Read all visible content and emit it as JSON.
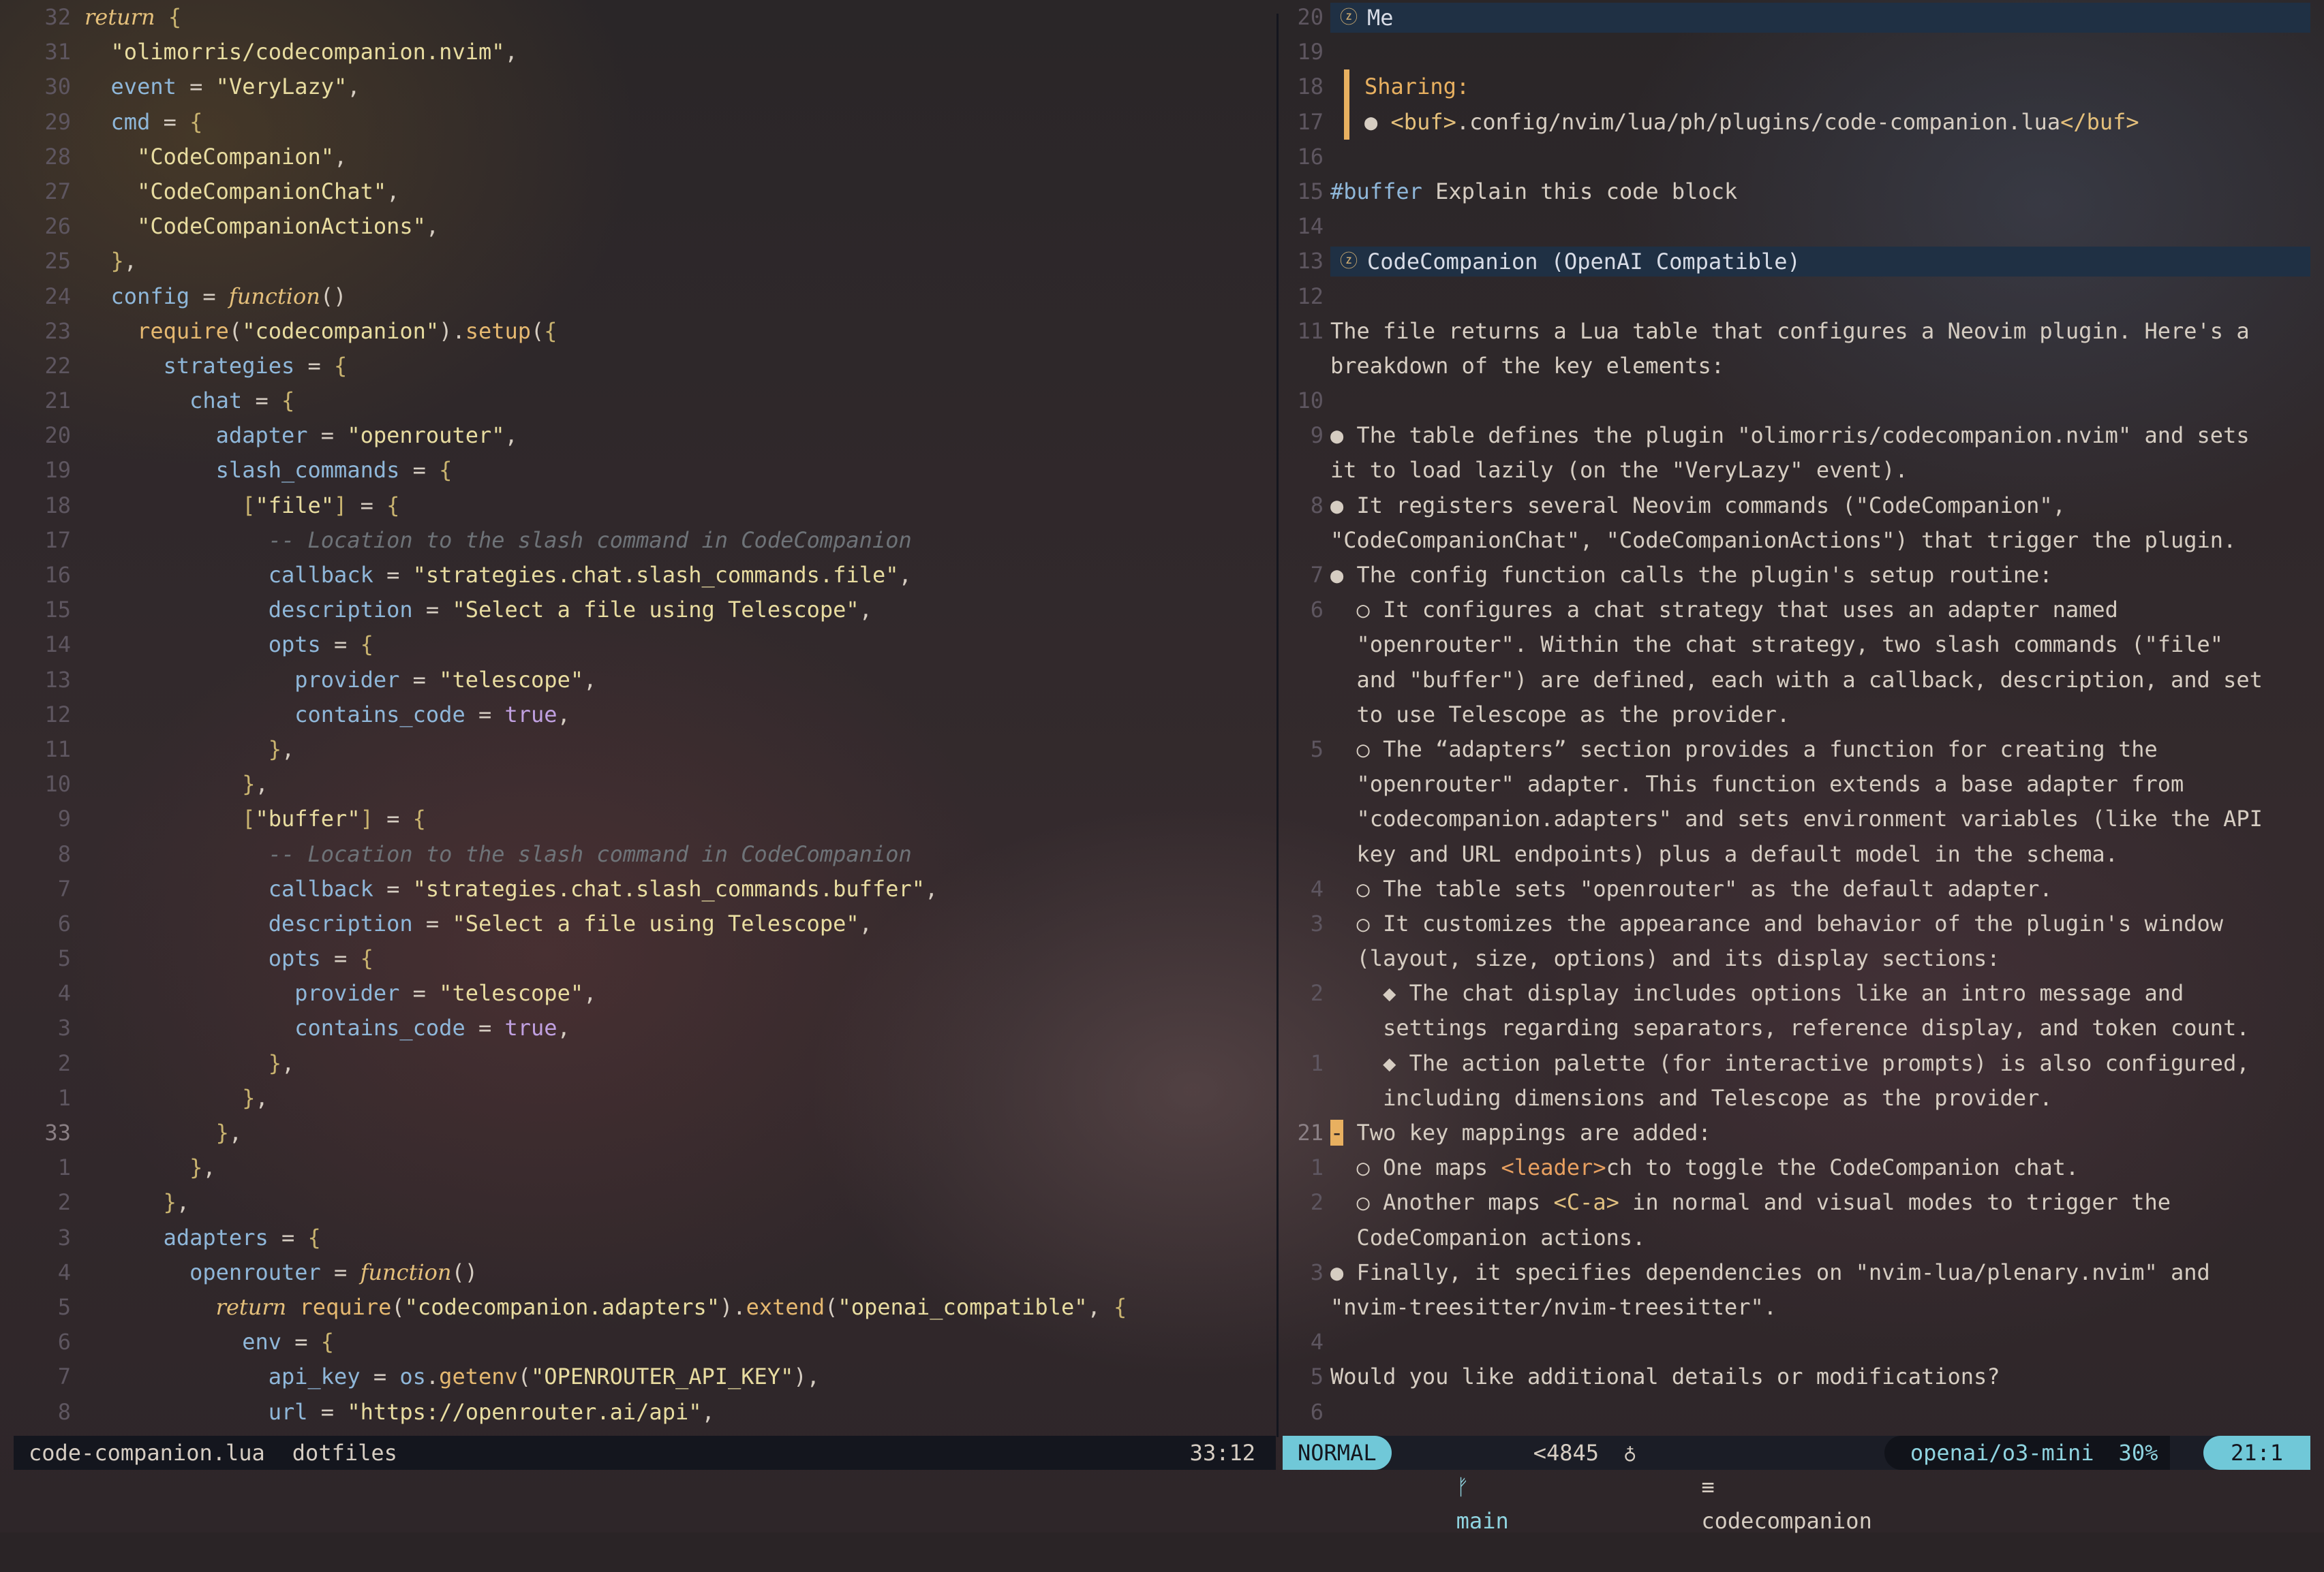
{
  "left_editor": {
    "lines": [
      {
        "n": "32",
        "t": [
          [
            "kw",
            "return"
          ],
          [
            "op",
            " "
          ],
          [
            "pun",
            "{"
          ]
        ]
      },
      {
        "n": "31",
        "t": [
          [
            "op",
            "  "
          ],
          [
            "str",
            "\"olimorris/codecompanion.nvim\""
          ],
          [
            "op",
            ","
          ]
        ]
      },
      {
        "n": "30",
        "t": [
          [
            "op",
            "  "
          ],
          [
            "fld",
            "event"
          ],
          [
            "op",
            " = "
          ],
          [
            "str",
            "\"VeryLazy\""
          ],
          [
            "op",
            ","
          ]
        ]
      },
      {
        "n": "29",
        "t": [
          [
            "op",
            "  "
          ],
          [
            "fld",
            "cmd"
          ],
          [
            "op",
            " = "
          ],
          [
            "pun",
            "{"
          ]
        ]
      },
      {
        "n": "28",
        "t": [
          [
            "op",
            "    "
          ],
          [
            "str",
            "\"CodeCompanion\""
          ],
          [
            "op",
            ","
          ]
        ]
      },
      {
        "n": "27",
        "t": [
          [
            "op",
            "    "
          ],
          [
            "str",
            "\"CodeCompanionChat\""
          ],
          [
            "op",
            ","
          ]
        ]
      },
      {
        "n": "26",
        "t": [
          [
            "op",
            "    "
          ],
          [
            "str",
            "\"CodeCompanionActions\""
          ],
          [
            "op",
            ","
          ]
        ]
      },
      {
        "n": "25",
        "t": [
          [
            "op",
            "  "
          ],
          [
            "pun",
            "}"
          ],
          [
            "op",
            ","
          ]
        ]
      },
      {
        "n": "24",
        "t": [
          [
            "op",
            "  "
          ],
          [
            "fld",
            "config"
          ],
          [
            "op",
            " = "
          ],
          [
            "kw",
            "function"
          ],
          [
            "op",
            "()"
          ]
        ]
      },
      {
        "n": "23",
        "t": [
          [
            "op",
            "    "
          ],
          [
            "fn",
            "require"
          ],
          [
            "op",
            "("
          ],
          [
            "str",
            "\"codecompanion\""
          ],
          [
            "op",
            ")."
          ],
          [
            "fn",
            "setup"
          ],
          [
            "op",
            "("
          ],
          [
            "pun",
            "{"
          ]
        ]
      },
      {
        "n": "22",
        "t": [
          [
            "op",
            "      "
          ],
          [
            "fld",
            "strategies"
          ],
          [
            "op",
            " = "
          ],
          [
            "pun",
            "{"
          ]
        ]
      },
      {
        "n": "21",
        "t": [
          [
            "op",
            "        "
          ],
          [
            "fld",
            "chat"
          ],
          [
            "op",
            " = "
          ],
          [
            "pun",
            "{"
          ]
        ]
      },
      {
        "n": "20",
        "t": [
          [
            "op",
            "          "
          ],
          [
            "fld",
            "adapter"
          ],
          [
            "op",
            " = "
          ],
          [
            "str",
            "\"openrouter\""
          ],
          [
            "op",
            ","
          ]
        ]
      },
      {
        "n": "19",
        "t": [
          [
            "op",
            "          "
          ],
          [
            "fld",
            "slash_commands"
          ],
          [
            "op",
            " = "
          ],
          [
            "pun",
            "{"
          ]
        ]
      },
      {
        "n": "18",
        "t": [
          [
            "op",
            "            "
          ],
          [
            "pun",
            "["
          ],
          [
            "str",
            "\"file\""
          ],
          [
            "pun",
            "]"
          ],
          [
            "op",
            " = "
          ],
          [
            "pun",
            "{"
          ]
        ]
      },
      {
        "n": "17",
        "t": [
          [
            "op",
            "              "
          ],
          [
            "cmt",
            "-- Location to the slash command in CodeCompanion"
          ]
        ]
      },
      {
        "n": "16",
        "t": [
          [
            "op",
            "              "
          ],
          [
            "fld",
            "callback"
          ],
          [
            "op",
            " = "
          ],
          [
            "str",
            "\"strategies.chat.slash_commands.file\""
          ],
          [
            "op",
            ","
          ]
        ]
      },
      {
        "n": "15",
        "t": [
          [
            "op",
            "              "
          ],
          [
            "fld",
            "description"
          ],
          [
            "op",
            " = "
          ],
          [
            "str",
            "\"Select a file using Telescope\""
          ],
          [
            "op",
            ","
          ]
        ]
      },
      {
        "n": "14",
        "t": [
          [
            "op",
            "              "
          ],
          [
            "fld",
            "opts"
          ],
          [
            "op",
            " = "
          ],
          [
            "pun",
            "{"
          ]
        ]
      },
      {
        "n": "13",
        "t": [
          [
            "op",
            "                "
          ],
          [
            "fld",
            "provider"
          ],
          [
            "op",
            " = "
          ],
          [
            "str",
            "\"telescope\""
          ],
          [
            "op",
            ","
          ]
        ]
      },
      {
        "n": "12",
        "t": [
          [
            "op",
            "                "
          ],
          [
            "fld",
            "contains_code"
          ],
          [
            "op",
            " = "
          ],
          [
            "bool",
            "true"
          ],
          [
            "op",
            ","
          ]
        ]
      },
      {
        "n": "11",
        "t": [
          [
            "op",
            "              "
          ],
          [
            "pun",
            "}"
          ],
          [
            "op",
            ","
          ]
        ]
      },
      {
        "n": "10",
        "t": [
          [
            "op",
            "            "
          ],
          [
            "pun",
            "}"
          ],
          [
            "op",
            ","
          ]
        ]
      },
      {
        "n": "9",
        "t": [
          [
            "op",
            "            "
          ],
          [
            "pun",
            "["
          ],
          [
            "str",
            "\"buffer\""
          ],
          [
            "pun",
            "]"
          ],
          [
            "op",
            " = "
          ],
          [
            "pun",
            "{"
          ]
        ]
      },
      {
        "n": "8",
        "t": [
          [
            "op",
            "              "
          ],
          [
            "cmt",
            "-- Location to the slash command in CodeCompanion"
          ]
        ]
      },
      {
        "n": "7",
        "t": [
          [
            "op",
            "              "
          ],
          [
            "fld",
            "callback"
          ],
          [
            "op",
            " = "
          ],
          [
            "str",
            "\"strategies.chat.slash_commands.buffer\""
          ],
          [
            "op",
            ","
          ]
        ]
      },
      {
        "n": "6",
        "t": [
          [
            "op",
            "              "
          ],
          [
            "fld",
            "description"
          ],
          [
            "op",
            " = "
          ],
          [
            "str",
            "\"Select a file using Telescope\""
          ],
          [
            "op",
            ","
          ]
        ]
      },
      {
        "n": "5",
        "t": [
          [
            "op",
            "              "
          ],
          [
            "fld",
            "opts"
          ],
          [
            "op",
            " = "
          ],
          [
            "pun",
            "{"
          ]
        ]
      },
      {
        "n": "4",
        "t": [
          [
            "op",
            "                "
          ],
          [
            "fld",
            "provider"
          ],
          [
            "op",
            " = "
          ],
          [
            "str",
            "\"telescope\""
          ],
          [
            "op",
            ","
          ]
        ]
      },
      {
        "n": "3",
        "t": [
          [
            "op",
            "                "
          ],
          [
            "fld",
            "contains_code"
          ],
          [
            "op",
            " = "
          ],
          [
            "bool",
            "true"
          ],
          [
            "op",
            ","
          ]
        ]
      },
      {
        "n": "2",
        "t": [
          [
            "op",
            "              "
          ],
          [
            "pun",
            "}"
          ],
          [
            "op",
            ","
          ]
        ]
      },
      {
        "n": "1",
        "t": [
          [
            "op",
            "            "
          ],
          [
            "pun",
            "}"
          ],
          [
            "op",
            ","
          ]
        ]
      },
      {
        "n": "33",
        "cur": true,
        "t": [
          [
            "op",
            "          "
          ],
          [
            "pun",
            "}"
          ],
          [
            "op",
            ","
          ]
        ]
      },
      {
        "n": "1",
        "t": [
          [
            "op",
            "        "
          ],
          [
            "pun",
            "}"
          ],
          [
            "op",
            ","
          ]
        ]
      },
      {
        "n": "2",
        "t": [
          [
            "op",
            "      "
          ],
          [
            "pun",
            "}"
          ],
          [
            "op",
            ","
          ]
        ]
      },
      {
        "n": "3",
        "t": [
          [
            "op",
            "      "
          ],
          [
            "fld",
            "adapters"
          ],
          [
            "op",
            " = "
          ],
          [
            "pun",
            "{"
          ]
        ]
      },
      {
        "n": "4",
        "t": [
          [
            "op",
            "        "
          ],
          [
            "fld",
            "openrouter"
          ],
          [
            "op",
            " = "
          ],
          [
            "kw",
            "function"
          ],
          [
            "op",
            "()"
          ]
        ]
      },
      {
        "n": "5",
        "t": [
          [
            "op",
            "          "
          ],
          [
            "kw",
            "return"
          ],
          [
            "op",
            " "
          ],
          [
            "fn",
            "require"
          ],
          [
            "op",
            "("
          ],
          [
            "str",
            "\"codecompanion.adapters\""
          ],
          [
            "op",
            ")."
          ],
          [
            "fn",
            "extend"
          ],
          [
            "op",
            "("
          ],
          [
            "str",
            "\"openai_compatible\""
          ],
          [
            "op",
            ", "
          ],
          [
            "pun",
            "{"
          ]
        ]
      },
      {
        "n": "6",
        "t": [
          [
            "op",
            "            "
          ],
          [
            "fld",
            "env"
          ],
          [
            "op",
            " = "
          ],
          [
            "pun",
            "{"
          ]
        ]
      },
      {
        "n": "7",
        "t": [
          [
            "op",
            "              "
          ],
          [
            "fld",
            "api_key"
          ],
          [
            "op",
            " = "
          ],
          [
            "fld",
            "os"
          ],
          [
            "op",
            "."
          ],
          [
            "fn",
            "getenv"
          ],
          [
            "op",
            "("
          ],
          [
            "str",
            "\"OPENROUTER_API_KEY\""
          ],
          [
            "op",
            "),"
          ]
        ]
      },
      {
        "n": "8",
        "t": [
          [
            "op",
            "              "
          ],
          [
            "fld",
            "url"
          ],
          [
            "op",
            " = "
          ],
          [
            "str",
            "\"https://openrouter.ai/api\""
          ],
          [
            "op",
            ","
          ]
        ]
      }
    ]
  },
  "right_chat": {
    "lines": [
      {
        "n": "20",
        "hdr": true,
        "icon": "ⓩ",
        "t": "Me"
      },
      {
        "n": "19",
        "t": ""
      },
      {
        "n": "18",
        "share": true,
        "t": "Sharing:"
      },
      {
        "n": "17",
        "share2": true,
        "bullet": "● ",
        "pre": "<buf>",
        "mid": ".config/nvim/lua/ph/plugins/code-companion.lua",
        "post": "</buf>"
      },
      {
        "n": "16",
        "t": ""
      },
      {
        "n": "15",
        "tagged": true,
        "tag": "#buffer",
        "t": " Explain this code block"
      },
      {
        "n": "14",
        "t": ""
      },
      {
        "n": "13",
        "hdr": true,
        "icon": "ⓩ",
        "t": "CodeCompanion (OpenAI Compatible)"
      },
      {
        "n": "12",
        "t": ""
      },
      {
        "n": "11",
        "t": "The file returns a Lua table that configures a Neovim plugin. Here's a"
      },
      {
        "n": "",
        "t": "breakdown of the key elements:"
      },
      {
        "n": "10",
        "t": ""
      },
      {
        "n": "9",
        "t": "● The table defines the plugin \"olimorris/codecompanion.nvim\" and sets"
      },
      {
        "n": "",
        "t": "it to load lazily (on the \"VeryLazy\" event)."
      },
      {
        "n": "8",
        "t": "● It registers several Neovim commands (\"CodeCompanion\","
      },
      {
        "n": "",
        "t": "\"CodeCompanionChat\", \"CodeCompanionActions\") that trigger the plugin."
      },
      {
        "n": "7",
        "t": "● The config function calls the plugin's setup routine:"
      },
      {
        "n": "6",
        "t": "  ○ It configures a chat strategy that uses an adapter named"
      },
      {
        "n": "",
        "t": "  \"openrouter\". Within the chat strategy, two slash commands (\"file\""
      },
      {
        "n": "",
        "t": "  and \"buffer\") are defined, each with a callback, description, and set"
      },
      {
        "n": "",
        "t": "  to use Telescope as the provider."
      },
      {
        "n": "5",
        "t": "  ○ The “adapters” section provides a function for creating the"
      },
      {
        "n": "",
        "t": "  \"openrouter\" adapter. This function extends a base adapter from"
      },
      {
        "n": "",
        "t": "  \"codecompanion.adapters\" and sets environment variables (like the API"
      },
      {
        "n": "",
        "t": "  key and URL endpoints) plus a default model in the schema."
      },
      {
        "n": "4",
        "t": "  ○ The table sets \"openrouter\" as the default adapter."
      },
      {
        "n": "3",
        "t": "  ○ It customizes the appearance and behavior of the plugin's window"
      },
      {
        "n": "",
        "t": "  (layout, size, options) and its display sections:"
      },
      {
        "n": "2",
        "t": "    ◆ The chat display includes options like an intro message and"
      },
      {
        "n": "",
        "t": "    settings regarding separators, reference display, and token count."
      },
      {
        "n": "1",
        "t": "    ◆ The action palette (for interactive prompts) is also configured,"
      },
      {
        "n": "",
        "t": "    including dimensions and Telescope as the provider."
      },
      {
        "n": "21",
        "cur": true,
        "cursor": "-",
        "t": " Two key mappings are added:"
      },
      {
        "n": "1",
        "t": "  ○ One maps ",
        "hl1": "<leader>",
        "rest1": "ch to toggle the CodeCompanion chat."
      },
      {
        "n": "2",
        "t": "  ○ Another maps ",
        "hl2": "<C-a>",
        "rest2": " in normal and visual modes to trigger the"
      },
      {
        "n": "",
        "t": "  CodeCompanion actions."
      },
      {
        "n": "3",
        "t": "● Finally, it specifies dependencies on \"nvim-lua/plenary.nvim\" and"
      },
      {
        "n": "",
        "t": "\"nvim-treesitter/nvim-treesitter\"."
      },
      {
        "n": "4",
        "t": ""
      },
      {
        "n": "5",
        "t": "Would you like additional details or modifications?"
      },
      {
        "n": "6",
        "t": ""
      }
    ]
  },
  "left_status": {
    "filename": "code-companion.lua",
    "project": "dotfiles",
    "position": "33:12"
  },
  "right_status": {
    "mode": "NORMAL",
    "branch_icon": "ᚠ",
    "branch": "main",
    "diff": "<4845",
    "lsp_icon": "♁",
    "ft_icon": "≡",
    "filetype": "codecompanion",
    "model": "openai/o3-mini",
    "percent": "30%",
    "linecol": "21:1"
  }
}
